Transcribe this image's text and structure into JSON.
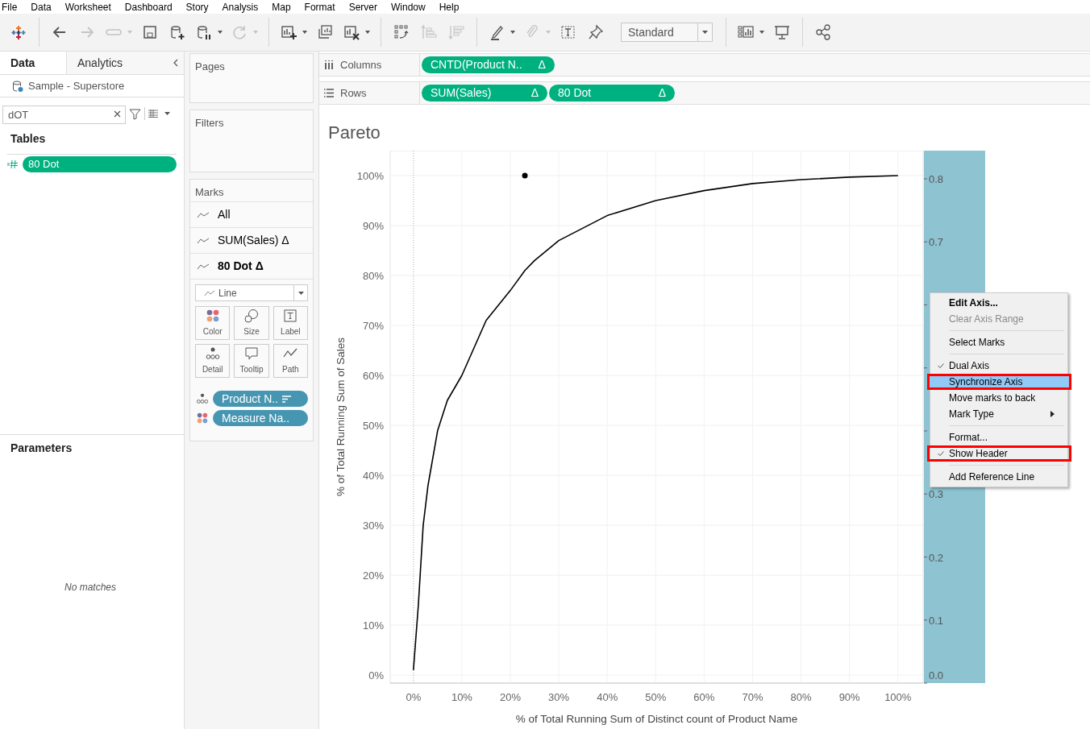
{
  "menu_bar": [
    "File",
    "Data",
    "Worksheet",
    "Dashboard",
    "Story",
    "Analysis",
    "Map",
    "Format",
    "Server",
    "Window",
    "Help"
  ],
  "toolbar": [
    {
      "kind": "logo"
    },
    {
      "kind": "separator"
    },
    {
      "kind": "back",
      "disabled": false,
      "caret": false
    },
    {
      "kind": "forward",
      "disabled": true,
      "caret": false
    },
    {
      "kind": "loop",
      "disabled": true,
      "caret": true
    },
    {
      "kind": "save",
      "disabled": false,
      "caret": false
    },
    {
      "kind": "new-datasource",
      "disabled": false,
      "caret": false
    },
    {
      "kind": "pause-datasource",
      "disabled": false,
      "caret": true
    },
    {
      "kind": "refresh",
      "disabled": true,
      "caret": true
    },
    {
      "kind": "separator"
    },
    {
      "kind": "new-sheet",
      "disabled": false,
      "caret": true
    },
    {
      "kind": "duplicate-sheet",
      "disabled": false,
      "caret": false
    },
    {
      "kind": "clear-sheet",
      "disabled": false,
      "caret": true
    },
    {
      "kind": "separator"
    },
    {
      "kind": "swap",
      "disabled": false,
      "caret": false
    },
    {
      "kind": "sort-ascending",
      "disabled": true,
      "caret": false
    },
    {
      "kind": "sort-descending",
      "disabled": true,
      "caret": false
    },
    {
      "kind": "separator"
    },
    {
      "kind": "highlight",
      "disabled": false,
      "caret": true
    },
    {
      "kind": "group",
      "disabled": true,
      "caret": true
    },
    {
      "kind": "text-label",
      "disabled": false,
      "caret": false
    },
    {
      "kind": "pin",
      "disabled": false,
      "caret": false
    },
    {
      "kind": "fit",
      "value": "Standard"
    },
    {
      "kind": "separator"
    },
    {
      "kind": "show-me",
      "disabled": false,
      "caret": true
    },
    {
      "kind": "presentation",
      "disabled": false,
      "caret": false
    },
    {
      "kind": "separator"
    },
    {
      "kind": "share",
      "disabled": false,
      "caret": false
    }
  ],
  "data_pane": {
    "tabs": [
      {
        "label": "Data",
        "selected": true
      },
      {
        "label": "Analytics",
        "selected": false
      }
    ],
    "data_source": "Sample - Superstore",
    "search": {
      "value": "dOT"
    },
    "tables_heading": "Tables",
    "fields": [
      {
        "label": "80 Dot"
      }
    ],
    "parameters_heading": "Parameters",
    "parameters_empty": "No matches"
  },
  "cards": {
    "pages": "Pages",
    "filters": "Filters",
    "marks": {
      "title": "Marks",
      "layers": [
        {
          "label": "All",
          "selected": false
        },
        {
          "label": "SUM(Sales)",
          "suffix": "Δ",
          "selected": false
        },
        {
          "label": "80 Dot",
          "suffix": "Δ",
          "selected": true
        }
      ],
      "mark_type": "Line",
      "buttons": [
        {
          "kind": "color",
          "label": "Color"
        },
        {
          "kind": "size",
          "label": "Size"
        },
        {
          "kind": "label",
          "label": "Label"
        },
        {
          "kind": "detail",
          "label": "Detail"
        },
        {
          "kind": "tooltip",
          "label": "Tooltip"
        },
        {
          "kind": "path",
          "label": "Path"
        }
      ],
      "pills": [
        {
          "kind": "detail",
          "label": "Product N..",
          "sorted": true
        },
        {
          "kind": "color",
          "label": "Measure Na..",
          "sorted": false
        }
      ]
    }
  },
  "columns": {
    "label": "Columns",
    "pills": [
      {
        "label": "CNTD(Product N..",
        "suffix": "Δ"
      }
    ]
  },
  "rows": {
    "label": "Rows",
    "pills": [
      {
        "label": "SUM(Sales)",
        "suffix": "Δ"
      },
      {
        "label": "80 Dot",
        "suffix": "Δ"
      }
    ]
  },
  "view": {
    "title": "Pareto",
    "chart_data": {
      "type": "line",
      "xlabel": "% of Total Running Sum of Distinct count of Product Name",
      "ylabel": "% of Total Running Sum of Sales",
      "x": [
        0,
        1,
        2,
        3,
        5,
        7,
        10,
        15,
        20,
        23,
        25,
        30,
        40,
        50,
        60,
        70,
        80,
        90,
        100
      ],
      "grid": true,
      "ref_lines": [
        {
          "axis": "x",
          "value": 0
        }
      ],
      "series": [
        {
          "color": "#000000",
          "marker": false,
          "values": [
            1,
            14,
            30,
            38,
            49,
            55,
            60,
            71,
            77,
            81,
            83,
            87,
            92,
            95,
            97,
            98.4,
            99.2,
            99.7,
            100
          ]
        },
        {
          "color": "#000000",
          "marker": true,
          "values": [
            null,
            null,
            null,
            null,
            null,
            null,
            null,
            null,
            null,
            100,
            null,
            null,
            null,
            null,
            null,
            null,
            null,
            null,
            null
          ]
        }
      ],
      "xlim": [
        -4.8,
        105.2
      ],
      "ylim": [
        -1.6,
        105
      ],
      "xticks": [
        {
          "value": 0,
          "label": "0%"
        },
        {
          "value": 10,
          "label": "10%"
        },
        {
          "value": 20,
          "label": "20%"
        },
        {
          "value": 30,
          "label": "30%"
        },
        {
          "value": 40,
          "label": "40%"
        },
        {
          "value": 50,
          "label": "50%"
        },
        {
          "value": 60,
          "label": "60%"
        },
        {
          "value": 70,
          "label": "70%"
        },
        {
          "value": 80,
          "label": "80%"
        },
        {
          "value": 90,
          "label": "90%"
        },
        {
          "value": 100,
          "label": "100%"
        }
      ],
      "yticks": [
        {
          "value": 0,
          "label": "0%"
        },
        {
          "value": 10,
          "label": "10%"
        },
        {
          "value": 20,
          "label": "20%"
        },
        {
          "value": 30,
          "label": "30%"
        },
        {
          "value": 40,
          "label": "40%"
        },
        {
          "value": 50,
          "label": "50%"
        },
        {
          "value": 60,
          "label": "60%"
        },
        {
          "value": 70,
          "label": "70%"
        },
        {
          "value": 80,
          "label": "80%"
        },
        {
          "value": 90,
          "label": "90%"
        },
        {
          "value": 100,
          "label": "100%"
        }
      ]
    },
    "right_axis": {
      "selected": true,
      "ticks": [
        "0.8",
        "0.7",
        "0.3",
        "0.2",
        "0.1",
        "0.0"
      ]
    }
  },
  "context_menu": {
    "items": [
      {
        "kind": "item",
        "label": "Edit Axis...",
        "default": true,
        "disabled": false,
        "checked": false,
        "selected": false,
        "submenu": false,
        "annotated": false
      },
      {
        "kind": "item",
        "label": "Clear Axis Range",
        "default": false,
        "disabled": true,
        "checked": false,
        "selected": false,
        "submenu": false,
        "annotated": false
      },
      {
        "kind": "separator"
      },
      {
        "kind": "item",
        "label": "Select Marks",
        "default": false,
        "disabled": false,
        "checked": false,
        "selected": false,
        "submenu": false,
        "annotated": false
      },
      {
        "kind": "separator"
      },
      {
        "kind": "item",
        "label": "Dual Axis",
        "default": false,
        "disabled": false,
        "checked": true,
        "selected": false,
        "submenu": false,
        "annotated": false
      },
      {
        "kind": "item",
        "label": "Synchronize Axis",
        "default": false,
        "disabled": false,
        "checked": false,
        "selected": true,
        "submenu": false,
        "annotated": true
      },
      {
        "kind": "item",
        "label": "Move marks to back",
        "default": false,
        "disabled": false,
        "checked": false,
        "selected": false,
        "submenu": false,
        "annotated": false
      },
      {
        "kind": "item",
        "label": "Mark Type",
        "default": false,
        "disabled": false,
        "checked": false,
        "selected": false,
        "submenu": true,
        "annotated": false
      },
      {
        "kind": "separator"
      },
      {
        "kind": "item",
        "label": "Format...",
        "default": false,
        "disabled": false,
        "checked": false,
        "selected": false,
        "submenu": false,
        "annotated": false
      },
      {
        "kind": "item",
        "label": "Show Header",
        "default": false,
        "disabled": false,
        "checked": true,
        "selected": false,
        "submenu": false,
        "annotated": true
      },
      {
        "kind": "separator"
      },
      {
        "kind": "item",
        "label": "Add Reference Line",
        "default": false,
        "disabled": false,
        "checked": false,
        "selected": false,
        "submenu": false,
        "annotated": false
      }
    ]
  }
}
